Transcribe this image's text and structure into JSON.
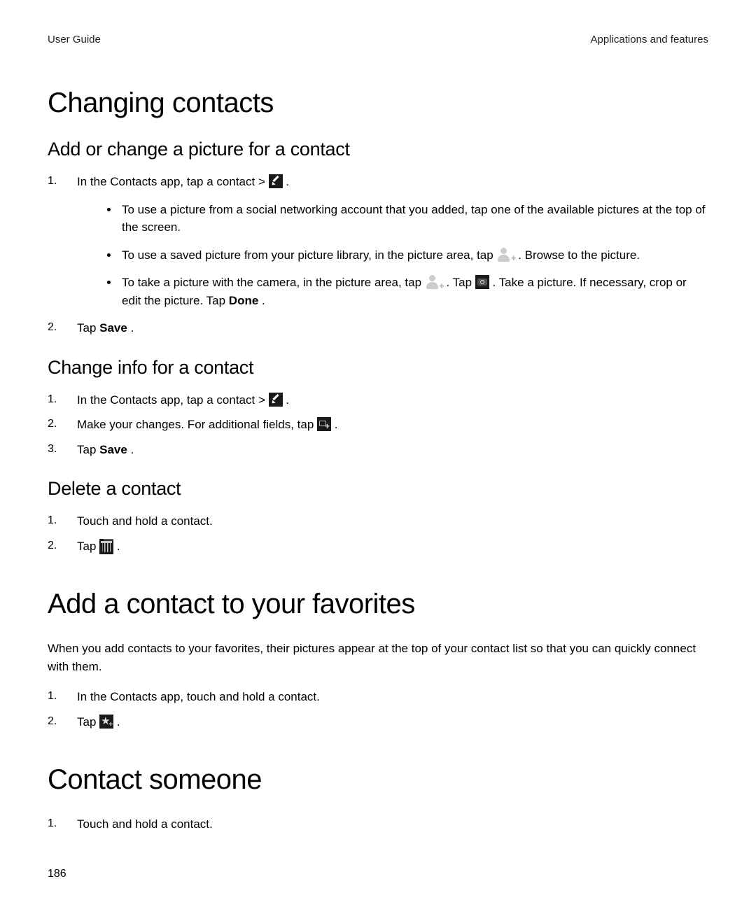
{
  "header": {
    "left": "User Guide",
    "right": "Applications and features"
  },
  "h1_1": "Changing contacts",
  "h2_1": "Add or change a picture for a contact",
  "sec1": {
    "step1_a": "In the Contacts app, tap a contact > ",
    "step1_c": " .",
    "bullets": {
      "b1": "To use a picture from a social networking account that you added, tap one of the available pictures at the top of the screen.",
      "b2_a": "To use a saved picture from your picture library, in the picture area, tap ",
      "b2_c": " . Browse to the picture.",
      "b3_a": "To take a picture with the camera, in the picture area, tap ",
      "b3_b": " . Tap ",
      "b3_c": " . Take a picture. If necessary, crop or edit the picture. Tap ",
      "b3_done": "Done",
      "b3_end": "."
    },
    "step2_a": "Tap ",
    "step2_save": "Save",
    "step2_end": "."
  },
  "h2_2": "Change info for a contact",
  "sec2": {
    "step1_a": "In the Contacts app, tap a contact > ",
    "step1_c": " .",
    "step2_a": "Make your changes. For additional fields, tap ",
    "step2_c": " .",
    "step3_a": "Tap ",
    "step3_save": "Save",
    "step3_end": "."
  },
  "h2_3": "Delete a contact",
  "sec3": {
    "step1": "Touch and hold a contact.",
    "step2_a": "Tap ",
    "step2_c": " ."
  },
  "h1_2": "Add a contact to your favorites",
  "fav_para": "When you add contacts to your favorites, their pictures appear at the top of your contact list so that you can quickly connect with them.",
  "sec4": {
    "step1": "In the Contacts app, touch and hold a contact.",
    "step2_a": "Tap ",
    "step2_c": " ."
  },
  "h1_3": "Contact someone",
  "sec5": {
    "step1": "Touch and hold a contact."
  },
  "page_number": "186"
}
